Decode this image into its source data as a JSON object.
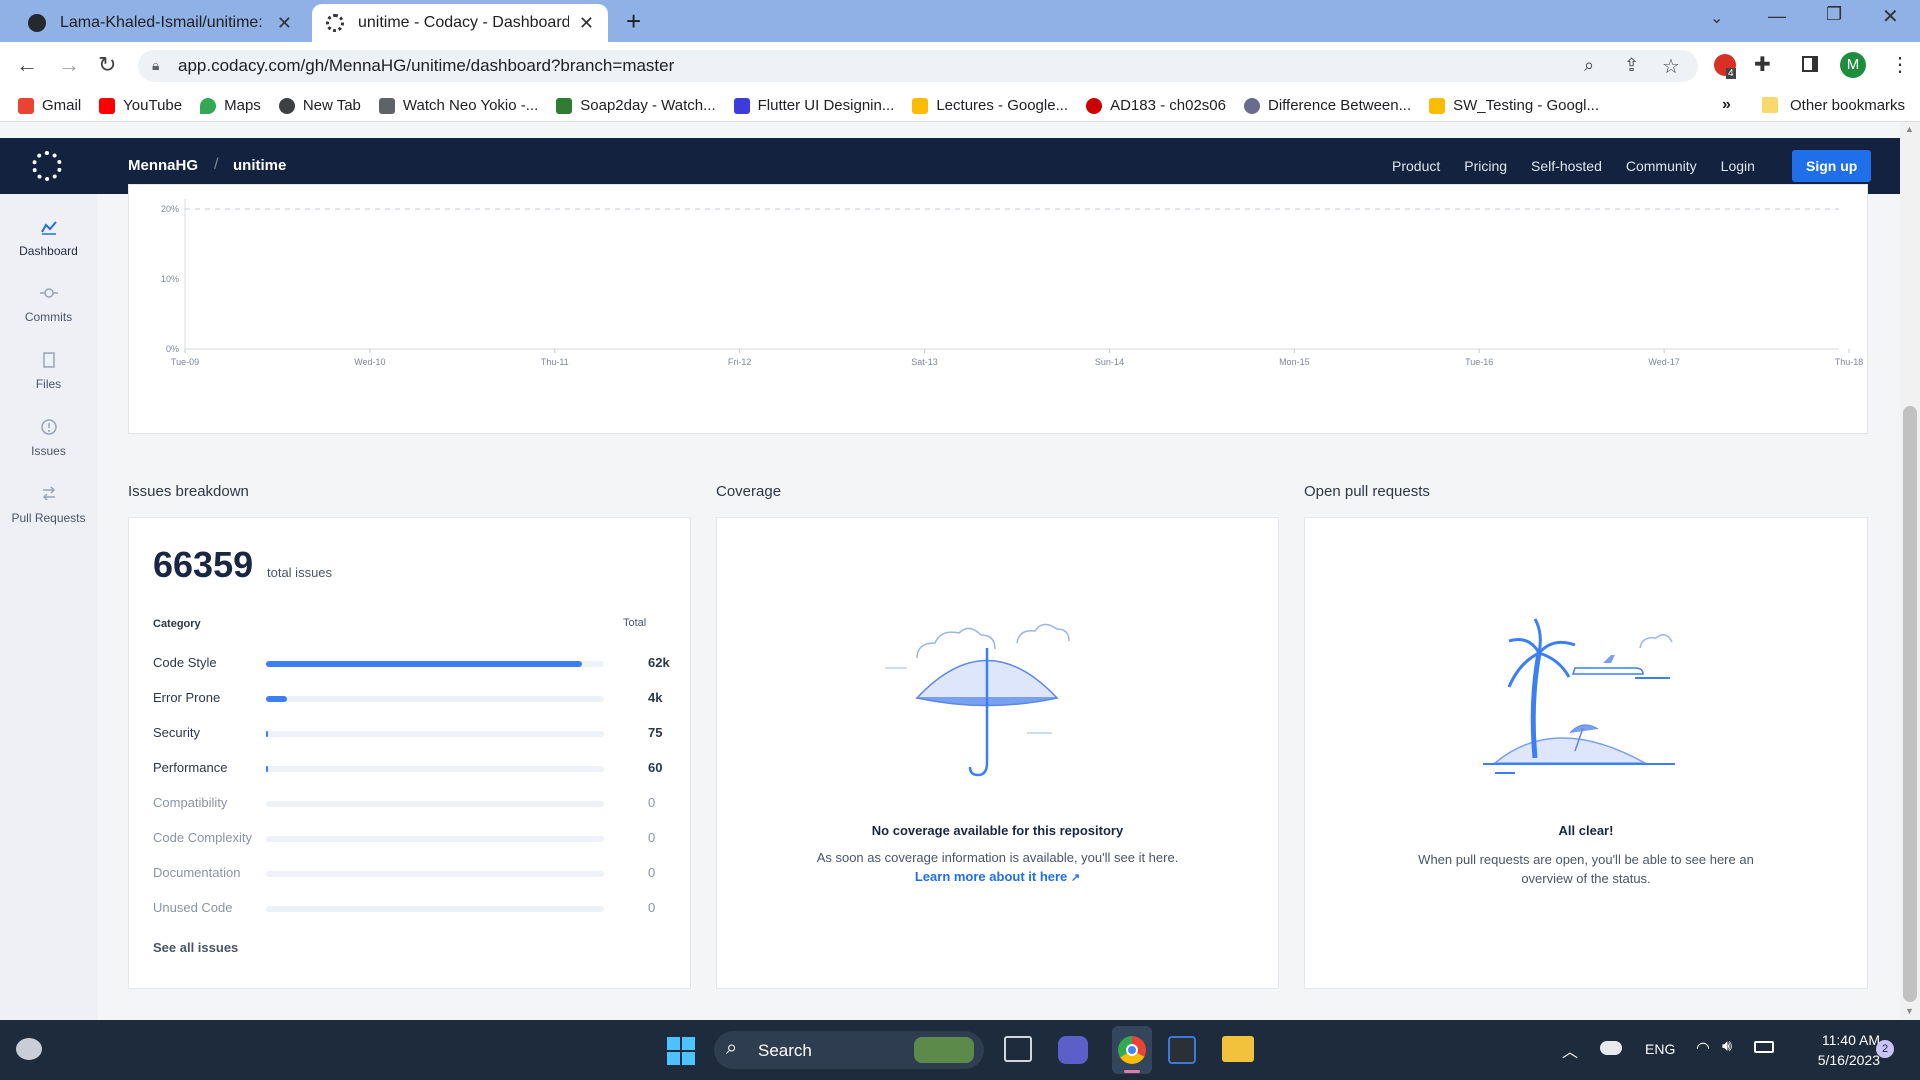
{
  "browser": {
    "tabs": [
      {
        "title": "Lama-Khaled-Ismail/unitime: Co",
        "active": false
      },
      {
        "title": "unitime - Codacy - Dashboard",
        "active": true
      }
    ],
    "url": "app.codacy.com/gh/MennaHG/unitime/dashboard?branch=master",
    "bookmarks": [
      "Gmail",
      "YouTube",
      "Maps",
      "New Tab",
      "Watch Neo Yokio -...",
      "Soap2day - Watch...",
      "Flutter UI Designin...",
      "Lectures - Google...",
      "AD183 - ch02s06",
      "Difference Between...",
      "SW_Testing - Googl..."
    ],
    "other_bookmarks": "Other bookmarks",
    "more_bookmarks": "»",
    "profile_initial": "M",
    "ext_badge": "4"
  },
  "header": {
    "org": "MennaHG",
    "separator": "/",
    "repo": "unitime",
    "nav": [
      "Product",
      "Pricing",
      "Self-hosted",
      "Community",
      "Login"
    ],
    "signup": "Sign up"
  },
  "sidebar": {
    "items": [
      {
        "label": "Dashboard",
        "icon": "chart-icon",
        "active": true
      },
      {
        "label": "Commits",
        "icon": "commit-icon"
      },
      {
        "label": "Files",
        "icon": "file-icon"
      },
      {
        "label": "Issues",
        "icon": "alert-icon"
      },
      {
        "label": "Pull Requests",
        "icon": "pull-request-icon"
      }
    ]
  },
  "chart_data": {
    "type": "line",
    "categories": [
      "Tue-09",
      "Wed-10",
      "Thu-11",
      "Fri-12",
      "Sat-13",
      "Sun-14",
      "Mon-15",
      "Tue-16",
      "Wed-17",
      "Thu-18"
    ],
    "y_ticks": [
      "20%",
      "10%",
      "0%"
    ],
    "ylim": [
      0,
      20
    ],
    "grid": "dashed line at 20%",
    "series": []
  },
  "issues": {
    "section_title": "Issues breakdown",
    "total": "66359",
    "total_label": "total issues",
    "col_category": "Category",
    "col_total": "Total",
    "rows": [
      {
        "name": "Code Style",
        "value": "62k",
        "fraction": 0.935
      },
      {
        "name": "Error Prone",
        "value": "4k",
        "fraction": 0.062
      },
      {
        "name": "Security",
        "value": "75",
        "fraction": 0.003
      },
      {
        "name": "Performance",
        "value": "60",
        "fraction": 0.003
      },
      {
        "name": "Compatibility",
        "value": "0",
        "fraction": 0
      },
      {
        "name": "Code Complexity",
        "value": "0",
        "fraction": 0
      },
      {
        "name": "Documentation",
        "value": "0",
        "fraction": 0
      },
      {
        "name": "Unused Code",
        "value": "0",
        "fraction": 0
      }
    ],
    "see_all": "See all issues"
  },
  "coverage": {
    "section_title": "Coverage",
    "heading": "No coverage available for this repository",
    "body": "As soon as coverage information is available, you'll see it here.",
    "link": "Learn more about it here"
  },
  "pull_requests": {
    "section_title": "Open pull requests",
    "heading": "All clear!",
    "body": "When pull requests are open, you'll be able to see here an overview of the status."
  },
  "taskbar": {
    "search": "Search",
    "lang": "ENG",
    "time": "11:40 AM",
    "date": "5/16/2023",
    "notif_count": "2"
  },
  "colors": {
    "accent": "#1f6feb",
    "header_bg": "#13233f",
    "bar": "#3b7ff2"
  }
}
